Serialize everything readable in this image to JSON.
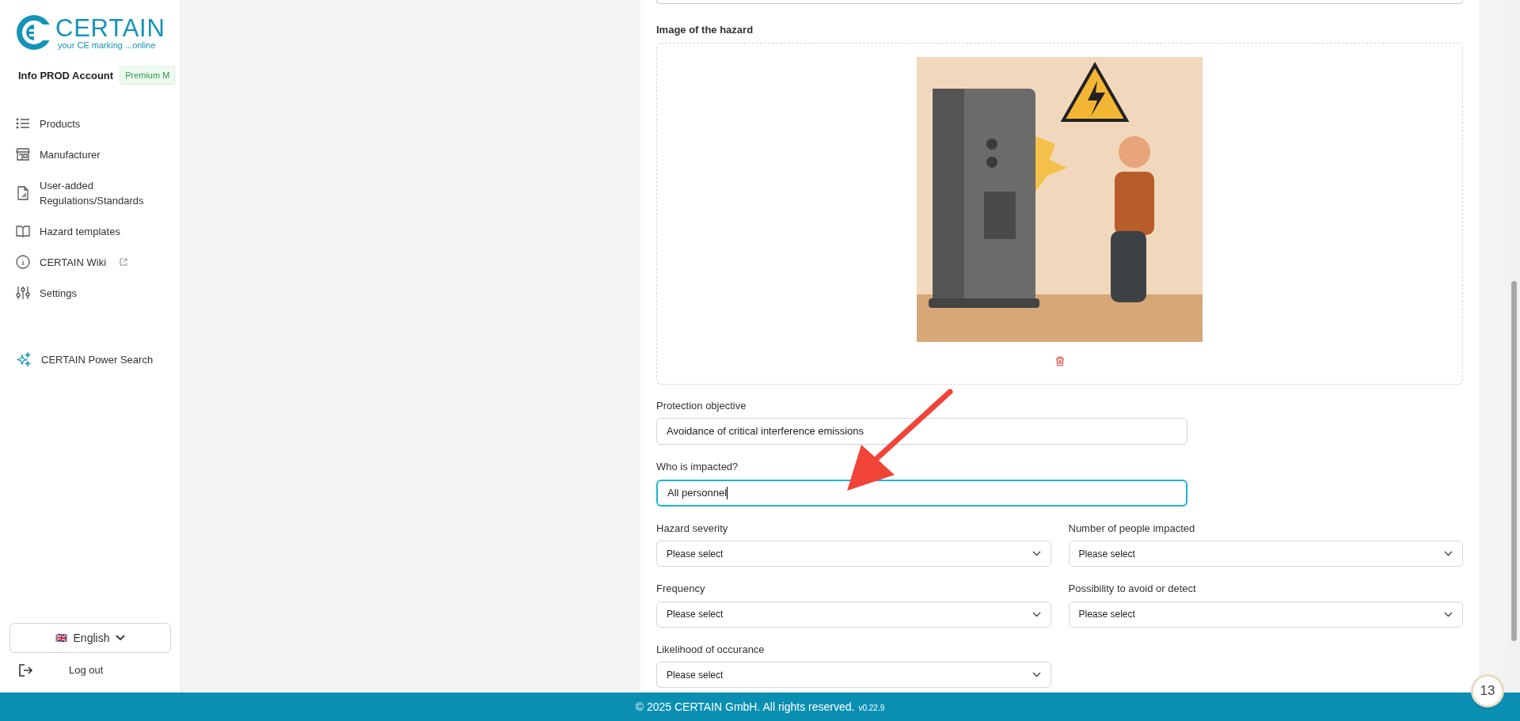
{
  "sidebar": {
    "logo": {
      "name": "CERTAIN",
      "tagline": "your CE marking ...online"
    },
    "account": {
      "name": "Info PROD Account",
      "plan": "Premium M"
    },
    "items": [
      {
        "label": "Products",
        "external": false
      },
      {
        "label": "Manufacturer",
        "external": false
      },
      {
        "label": "User-added Regulations/Standards",
        "external": false
      },
      {
        "label": "Hazard templates",
        "external": false
      },
      {
        "label": "CERTAIN Wiki",
        "external": true
      },
      {
        "label": "Settings",
        "external": false
      }
    ],
    "power_search": {
      "label": "CERTAIN Power Search"
    },
    "language": {
      "flag": "🇬🇧",
      "label": "English"
    },
    "logout": {
      "label": "Log out"
    }
  },
  "form": {
    "image_label": "Image of the hazard",
    "rows": [
      [
        {
          "kind": "text",
          "label": "Protection objective",
          "value": "Avoidance of critical interference emissions",
          "focused": false
        }
      ],
      [
        {
          "kind": "text",
          "label": "Who is impacted?",
          "value": "All personnel",
          "focused": true
        }
      ],
      [
        {
          "kind": "select",
          "label": "Hazard severity",
          "value": "Please select",
          "focused": false
        },
        {
          "kind": "select",
          "label": "Number of people impacted",
          "value": "Please select",
          "focused": false
        }
      ],
      [
        {
          "kind": "select",
          "label": "Frequency",
          "value": "Please select",
          "focused": false
        },
        {
          "kind": "select",
          "label": "Possibility to avoid or detect",
          "value": "Please select",
          "focused": false
        }
      ],
      [
        {
          "kind": "select",
          "label": "Likelihood of occurance",
          "value": "Please select",
          "focused": false
        }
      ]
    ]
  },
  "footer": {
    "copyright": "© 2025 CERTAIN GmbH. All rights reserved.",
    "version": "v0.22.9"
  },
  "notification_badge": {
    "count": "13"
  }
}
